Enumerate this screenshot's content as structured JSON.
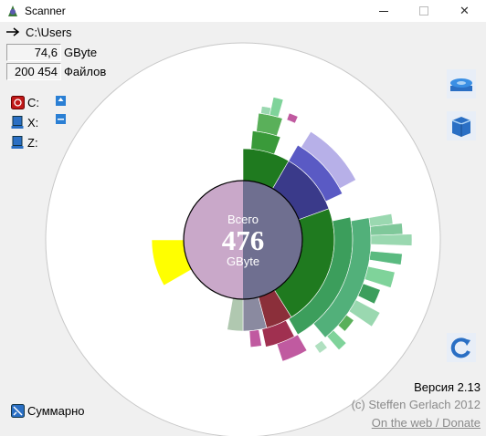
{
  "window": {
    "title": "Scanner",
    "close_glyph": "✕"
  },
  "path": {
    "icon": "arrow-right-icon",
    "text": "C:\\Users"
  },
  "stats": {
    "size_value": "74,6",
    "size_unit": "GByte",
    "files_value": "200 454",
    "files_label": "Файлов"
  },
  "drives": [
    {
      "letter": "C:",
      "icon": "drive-red-icon"
    },
    {
      "letter": "X:",
      "icon": "drive-blue-icon"
    },
    {
      "letter": "Z:",
      "icon": "drive-blue-icon"
    }
  ],
  "center": {
    "label_top": "Всего",
    "value": "476",
    "label_bottom": "GByte"
  },
  "summary": {
    "label": "Суммарно",
    "icon": "summary-icon"
  },
  "footer": {
    "version": "Версия 2.13",
    "copyright": "(c) Steffen Gerlach 2012",
    "link": "On the web / Donate"
  },
  "colors": {
    "disk_used": "#c9a8c9",
    "disk_overlay": "#6f6f90",
    "green_dark": "#1f7a1f",
    "green_mid": "#3c9e5c",
    "green_light": "#7fd39a",
    "blue": "#5a5ac4",
    "lavender": "#b7b0e8",
    "yellow": "#ffff00",
    "maroon": "#8b2f3a",
    "magenta": "#c05aa0"
  }
}
